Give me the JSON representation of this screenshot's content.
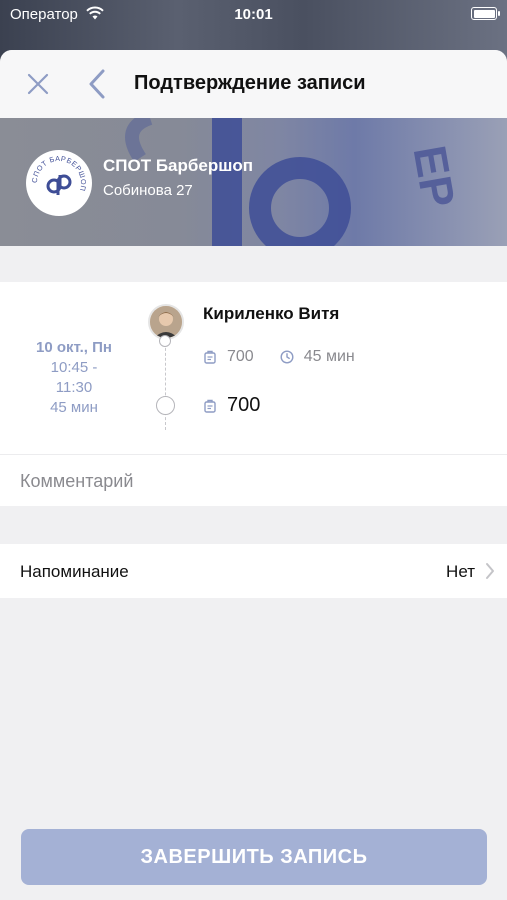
{
  "status_bar": {
    "carrier": "Оператор",
    "time": "10:01"
  },
  "nav": {
    "title": "Подтверждение записи"
  },
  "salon": {
    "name": "СПОТ Барбершоп",
    "address": "Собинова 27",
    "logo_text": "СПОТ БАРБЕРШОП"
  },
  "appointment": {
    "date": "10 окт., Пн",
    "time_start": "10:45 -",
    "time_end": "11:30",
    "duration": "45 мин",
    "master_name": "Кириленко Витя",
    "service_price": "700",
    "service_duration": "45 мин",
    "total_price": "700"
  },
  "comment": {
    "placeholder": "Комментарий",
    "value": ""
  },
  "reminder": {
    "label": "Напоминание",
    "value": "Нет"
  },
  "submit_button": {
    "label": "ЗАВЕРШИТЬ ЗАПИСЬ"
  },
  "colors": {
    "accent": "#8e9cc4",
    "button": "#a4b1d5",
    "background": "#f0f0f2"
  }
}
